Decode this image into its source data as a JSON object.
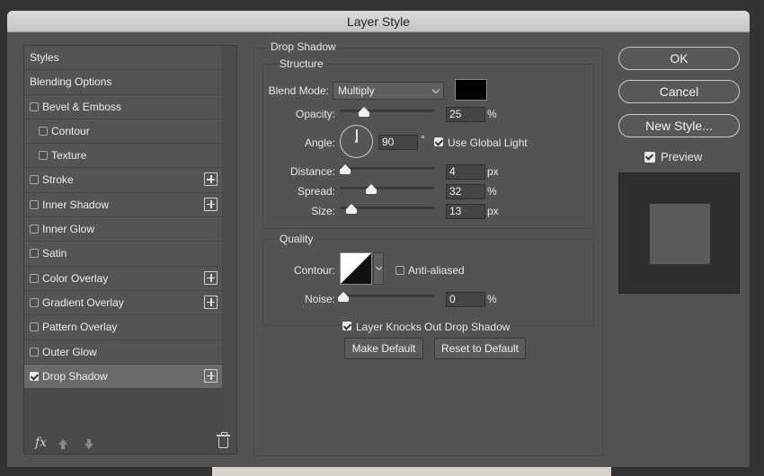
{
  "window": {
    "title": "Layer Style"
  },
  "styles_list": {
    "items": [
      {
        "label": "Styles",
        "type": "header",
        "checkbox": false,
        "checked": false,
        "plus": false,
        "selected": false
      },
      {
        "label": "Blending Options",
        "type": "header",
        "checkbox": false,
        "checked": false,
        "plus": false,
        "selected": false
      },
      {
        "label": "Bevel & Emboss",
        "type": "item",
        "checkbox": true,
        "checked": false,
        "plus": false,
        "selected": false
      },
      {
        "label": "Contour",
        "type": "sub",
        "checkbox": true,
        "checked": false,
        "plus": false,
        "selected": false
      },
      {
        "label": "Texture",
        "type": "sub",
        "checkbox": true,
        "checked": false,
        "plus": false,
        "selected": false
      },
      {
        "label": "Stroke",
        "type": "item",
        "checkbox": true,
        "checked": false,
        "plus": true,
        "selected": false
      },
      {
        "label": "Inner Shadow",
        "type": "item",
        "checkbox": true,
        "checked": false,
        "plus": true,
        "selected": false
      },
      {
        "label": "Inner Glow",
        "type": "item",
        "checkbox": true,
        "checked": false,
        "plus": false,
        "selected": false
      },
      {
        "label": "Satin",
        "type": "item",
        "checkbox": true,
        "checked": false,
        "plus": false,
        "selected": false
      },
      {
        "label": "Color Overlay",
        "type": "item",
        "checkbox": true,
        "checked": false,
        "plus": true,
        "selected": false
      },
      {
        "label": "Gradient Overlay",
        "type": "item",
        "checkbox": true,
        "checked": false,
        "plus": true,
        "selected": false
      },
      {
        "label": "Pattern Overlay",
        "type": "item",
        "checkbox": true,
        "checked": false,
        "plus": false,
        "selected": false
      },
      {
        "label": "Outer Glow",
        "type": "item",
        "checkbox": true,
        "checked": false,
        "plus": false,
        "selected": false
      },
      {
        "label": "Drop Shadow",
        "type": "item",
        "checkbox": true,
        "checked": true,
        "plus": true,
        "selected": true
      }
    ],
    "footer": {
      "fx_label": "fx"
    }
  },
  "drop_shadow": {
    "section_title": "Drop Shadow",
    "structure": {
      "title": "Structure",
      "blend_mode_label": "Blend Mode:",
      "blend_mode_value": "Multiply",
      "shadow_color": "#000000",
      "opacity_label": "Opacity:",
      "opacity_value": "25",
      "opacity_unit": "%",
      "opacity_fraction": 0.25,
      "angle_label": "Angle:",
      "angle_value": "90",
      "angle_unit": "°",
      "use_global_light_label": "Use Global Light",
      "use_global_light_checked": true,
      "distance_label": "Distance:",
      "distance_value": "4",
      "distance_unit": "px",
      "spread_label": "Spread:",
      "spread_value": "32",
      "spread_unit": "%",
      "size_label": "Size:",
      "size_value": "13",
      "size_unit": "px"
    },
    "quality": {
      "title": "Quality",
      "contour_label": "Contour:",
      "anti_aliased_label": "Anti-aliased",
      "anti_aliased_checked": false,
      "noise_label": "Noise:",
      "noise_value": "0",
      "noise_unit": "%"
    },
    "knocks_out_label": "Layer Knocks Out Drop Shadow",
    "knocks_out_checked": true,
    "make_default_label": "Make Default",
    "reset_default_label": "Reset to Default"
  },
  "right_panel": {
    "ok_label": "OK",
    "cancel_label": "Cancel",
    "new_style_label": "New Style...",
    "preview_label": "Preview",
    "preview_checked": true
  }
}
